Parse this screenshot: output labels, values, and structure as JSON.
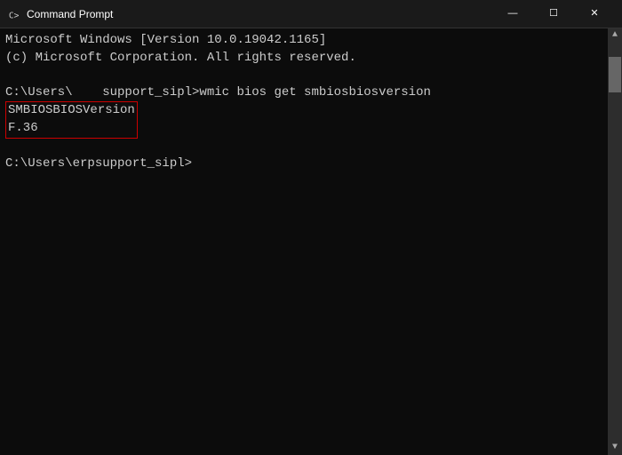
{
  "titlebar": {
    "icon_label": "cmd-icon",
    "title": "Command Prompt",
    "minimize_label": "—",
    "maximize_label": "☐",
    "close_label": "✕"
  },
  "terminal": {
    "lines": [
      "Microsoft Windows [Version 10.0.19042.1165]",
      "(c) Microsoft Corporation. All rights reserved.",
      "",
      "C:\\Users\\    support_sipl>wmic bios get smbiosbiosversion",
      "SMBIOSBIOSVersion",
      "F.36",
      "",
      "C:\\Users\\erpsupport_sipl>"
    ],
    "highlighted_lines": [
      "SMBIOSBIOSVersion",
      "F.36"
    ],
    "prompt_line": "C:\\Users\\erpsupport_sipl>"
  }
}
